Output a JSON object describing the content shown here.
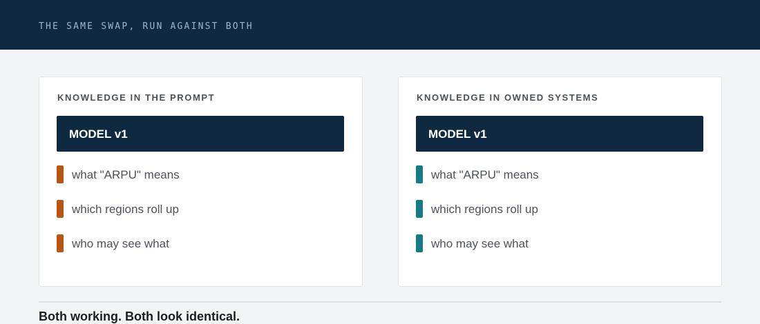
{
  "header": {
    "title": "THE SAME SWAP, RUN AGAINST BOTH"
  },
  "panels": [
    {
      "heading": "KNOWLEDGE IN THE PROMPT",
      "model_label": "MODEL v1",
      "marker_color": "#b65613",
      "items": [
        {
          "label": "what \"ARPU\" means"
        },
        {
          "label": "which regions roll up"
        },
        {
          "label": "who may see what"
        }
      ]
    },
    {
      "heading": "KNOWLEDGE IN OWNED SYSTEMS",
      "model_label": "MODEL v1",
      "marker_color": "#167b85",
      "items": [
        {
          "label": "what \"ARPU\" means"
        },
        {
          "label": "which regions roll up"
        },
        {
          "label": "who may see what"
        }
      ]
    }
  ],
  "footer": {
    "caption": "Both working. Both look identical."
  },
  "colors": {
    "header_background": "#0f2a40",
    "model_box": "#0f2a40",
    "prompt_marker": "#b65613",
    "systems_marker": "#167b85"
  }
}
